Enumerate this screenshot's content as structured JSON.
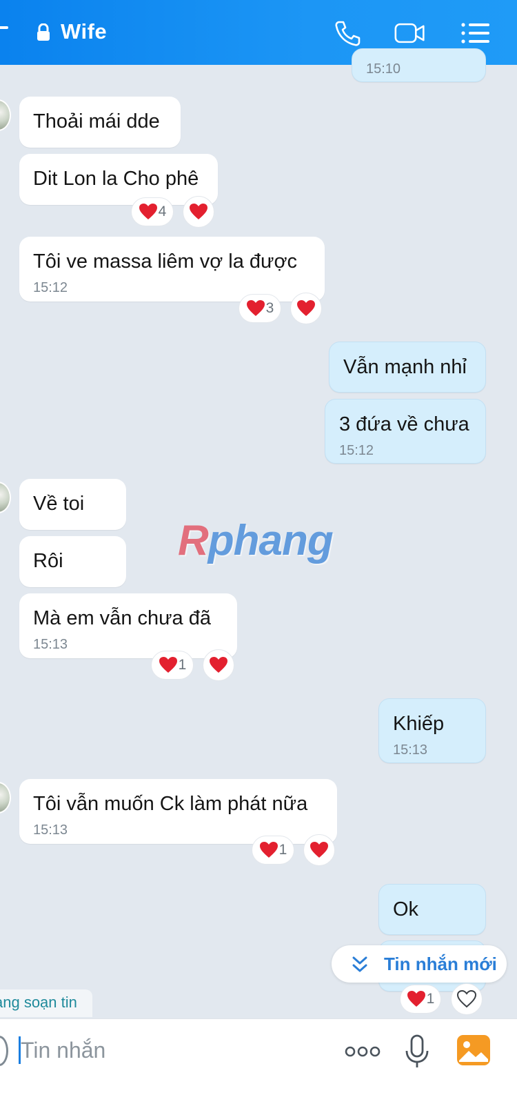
{
  "header": {
    "title": "Wife"
  },
  "partial_top_time": "15:10",
  "messages": [
    {
      "text": "Thoải mái dde"
    },
    {
      "text": "Dit Lon la Cho phê",
      "reaction_count": "4"
    },
    {
      "text": "Tôi ve massa liêm vợ la được",
      "time": "15:12",
      "reaction_count": "3"
    },
    {
      "text": "Vẫn mạnh nhỉ"
    },
    {
      "text": "3 đứa về chưa",
      "time": "15:12"
    },
    {
      "text": "Về toi"
    },
    {
      "text": "Rôi"
    },
    {
      "text": "Mà em vẫn chưa đã",
      "time": "15:13",
      "reaction_count": "1"
    },
    {
      "text": "Khiếp",
      "time": "15:13"
    },
    {
      "text": "Tôi vẫn muốn Ck làm phát nữa",
      "time": "15:13",
      "reaction_count": "1"
    },
    {
      "text": "Ok"
    },
    {
      "reaction_count": "1"
    }
  ],
  "watermark": {
    "first": "R",
    "rest": "phang"
  },
  "new_messages_label": "Tin nhắn mới",
  "typing_text": "ang soạn tin",
  "composer": {
    "placeholder": "Tin nhắn"
  },
  "colors": {
    "header": "#0a82ee",
    "my_bubble": "#d5eefc",
    "their_bubble": "#ffffff",
    "background": "#e2e8ef",
    "heart": "#e3202f"
  }
}
